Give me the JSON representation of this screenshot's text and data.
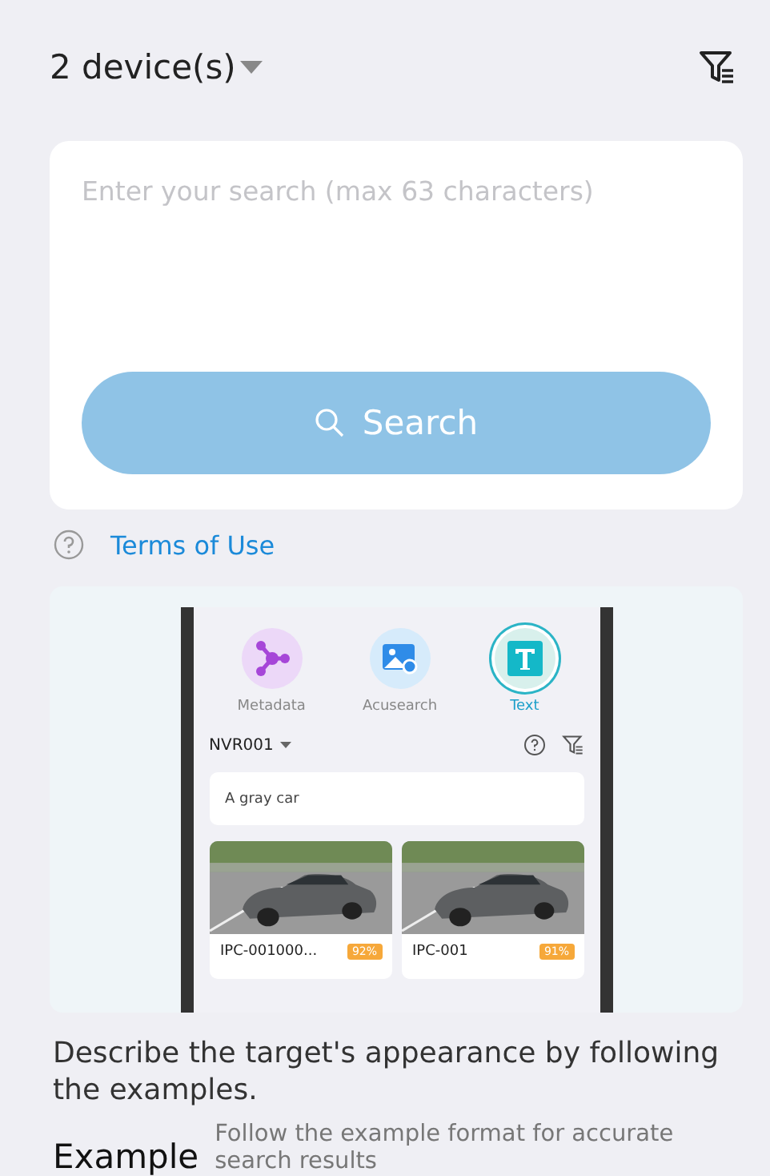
{
  "header": {
    "title": "2 device(s)"
  },
  "search": {
    "placeholder": "Enter your search (max 63 characters)",
    "button": "Search"
  },
  "terms": {
    "label": "Terms of Use"
  },
  "preview": {
    "modes": [
      {
        "label": "Metadata",
        "kind": "metadata",
        "selected": false
      },
      {
        "label": "Acusearch",
        "kind": "acusearch",
        "selected": false
      },
      {
        "label": "Text",
        "kind": "text",
        "selected": true
      }
    ],
    "device": "NVR001",
    "query": "A gray car",
    "results": [
      {
        "name": "IPC-001000...",
        "score": "92%",
        "kind": "picture"
      },
      {
        "name": "IPC-001",
        "score": "91%",
        "kind": "picture"
      }
    ]
  },
  "description": "Describe the target's appearance by following the examples.",
  "example": {
    "title": "Example",
    "text": "Follow the example format for accurate search results"
  }
}
